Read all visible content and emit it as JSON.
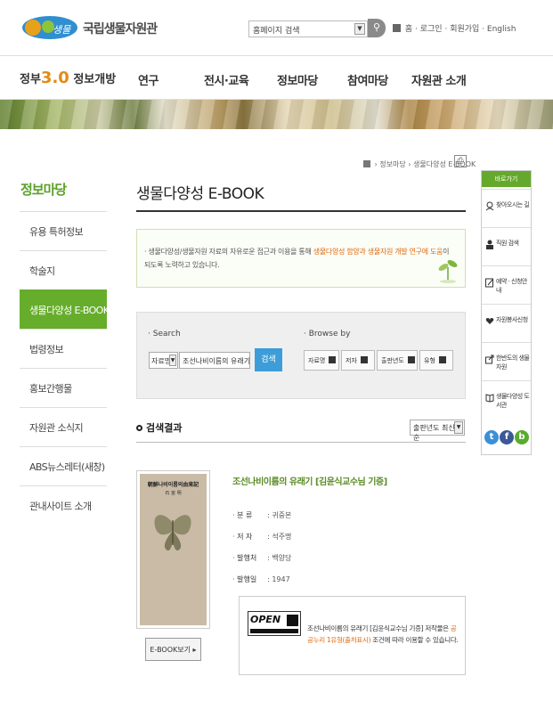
{
  "header": {
    "logo_text": "국립생물자원관",
    "search_select": "홈페이지 검색",
    "util_links": [
      "홈",
      "로그인",
      "회원가입",
      "English"
    ]
  },
  "gnb": {
    "gov30_prefix": "정부",
    "gov30_num": "3.0",
    "gov30_label": "정보개방",
    "menus": [
      "연구",
      "전시·교육",
      "정보마당",
      "참여마당",
      "자원관 소개"
    ]
  },
  "sidebar": {
    "title": "정보마당",
    "items": [
      "유용 특허정보",
      "학술지",
      "생물다양성 E-BOOK",
      "법령정보",
      "홍보간행물",
      "자원관 소식지",
      "ABS뉴스레터(새창)",
      "관내사이트 소개"
    ],
    "active_index": 2
  },
  "breadcrumb": [
    "정보마당",
    "생물다양성 E-BOOK"
  ],
  "page_title": "생물다양성 E-BOOK",
  "notice": {
    "lead": "생물다양성/생물자원 자료의 자유로운 접근과 이용을 통해 ",
    "highlight": "생물다양성 함양과 생물자원 개발 연구에 도움",
    "tail": "이 되도록 노력하고 있습니다."
  },
  "search": {
    "search_label": "Search",
    "browse_label": "Browse by",
    "field_select": "자료명",
    "query": "조선나비이름의 유래기",
    "search_button": "검색",
    "browse_buttons": [
      "자료명",
      "저자",
      "출판년도",
      "유형"
    ]
  },
  "results": {
    "title": "검색결과",
    "sort_select": "출판년도 최신순"
  },
  "book": {
    "cover_title": "朝鮮나비이름의由來記",
    "cover_sub": "石 宙 明",
    "title": "조선나비이름의 유래기 [김윤식교수님 기증]",
    "meta": [
      {
        "label": "분 류",
        "value": ": 귀중본"
      },
      {
        "label": "저 자",
        "value": ": 석주명"
      },
      {
        "label": "발행처",
        "value": ": 백양당"
      },
      {
        "label": "발행일",
        "value": ": 1947"
      }
    ],
    "ebook_button": "E-BOOK보기",
    "license_logo": "OPEN",
    "license_lead": "조선나비이름의 유래기 [김윤식교수님 기증] 저작물은 ",
    "license_highlight": "공공누리 1유형(출처표시)",
    "license_tail": " 조건에 따라 이용할 수 있습니다."
  },
  "quick": {
    "head": "바로가기",
    "items": [
      "찾아오시는 길",
      "직원 검색",
      "예약 · 신청안내",
      "자원봉사신청",
      "한반도의 생물자원",
      "생물다양성 도서관"
    ],
    "sns": [
      "t",
      "f",
      "b"
    ]
  },
  "colors": {
    "brand_green": "#67ad2c",
    "accent_orange": "#e06b0f",
    "search_blue": "#3d9dd8"
  }
}
